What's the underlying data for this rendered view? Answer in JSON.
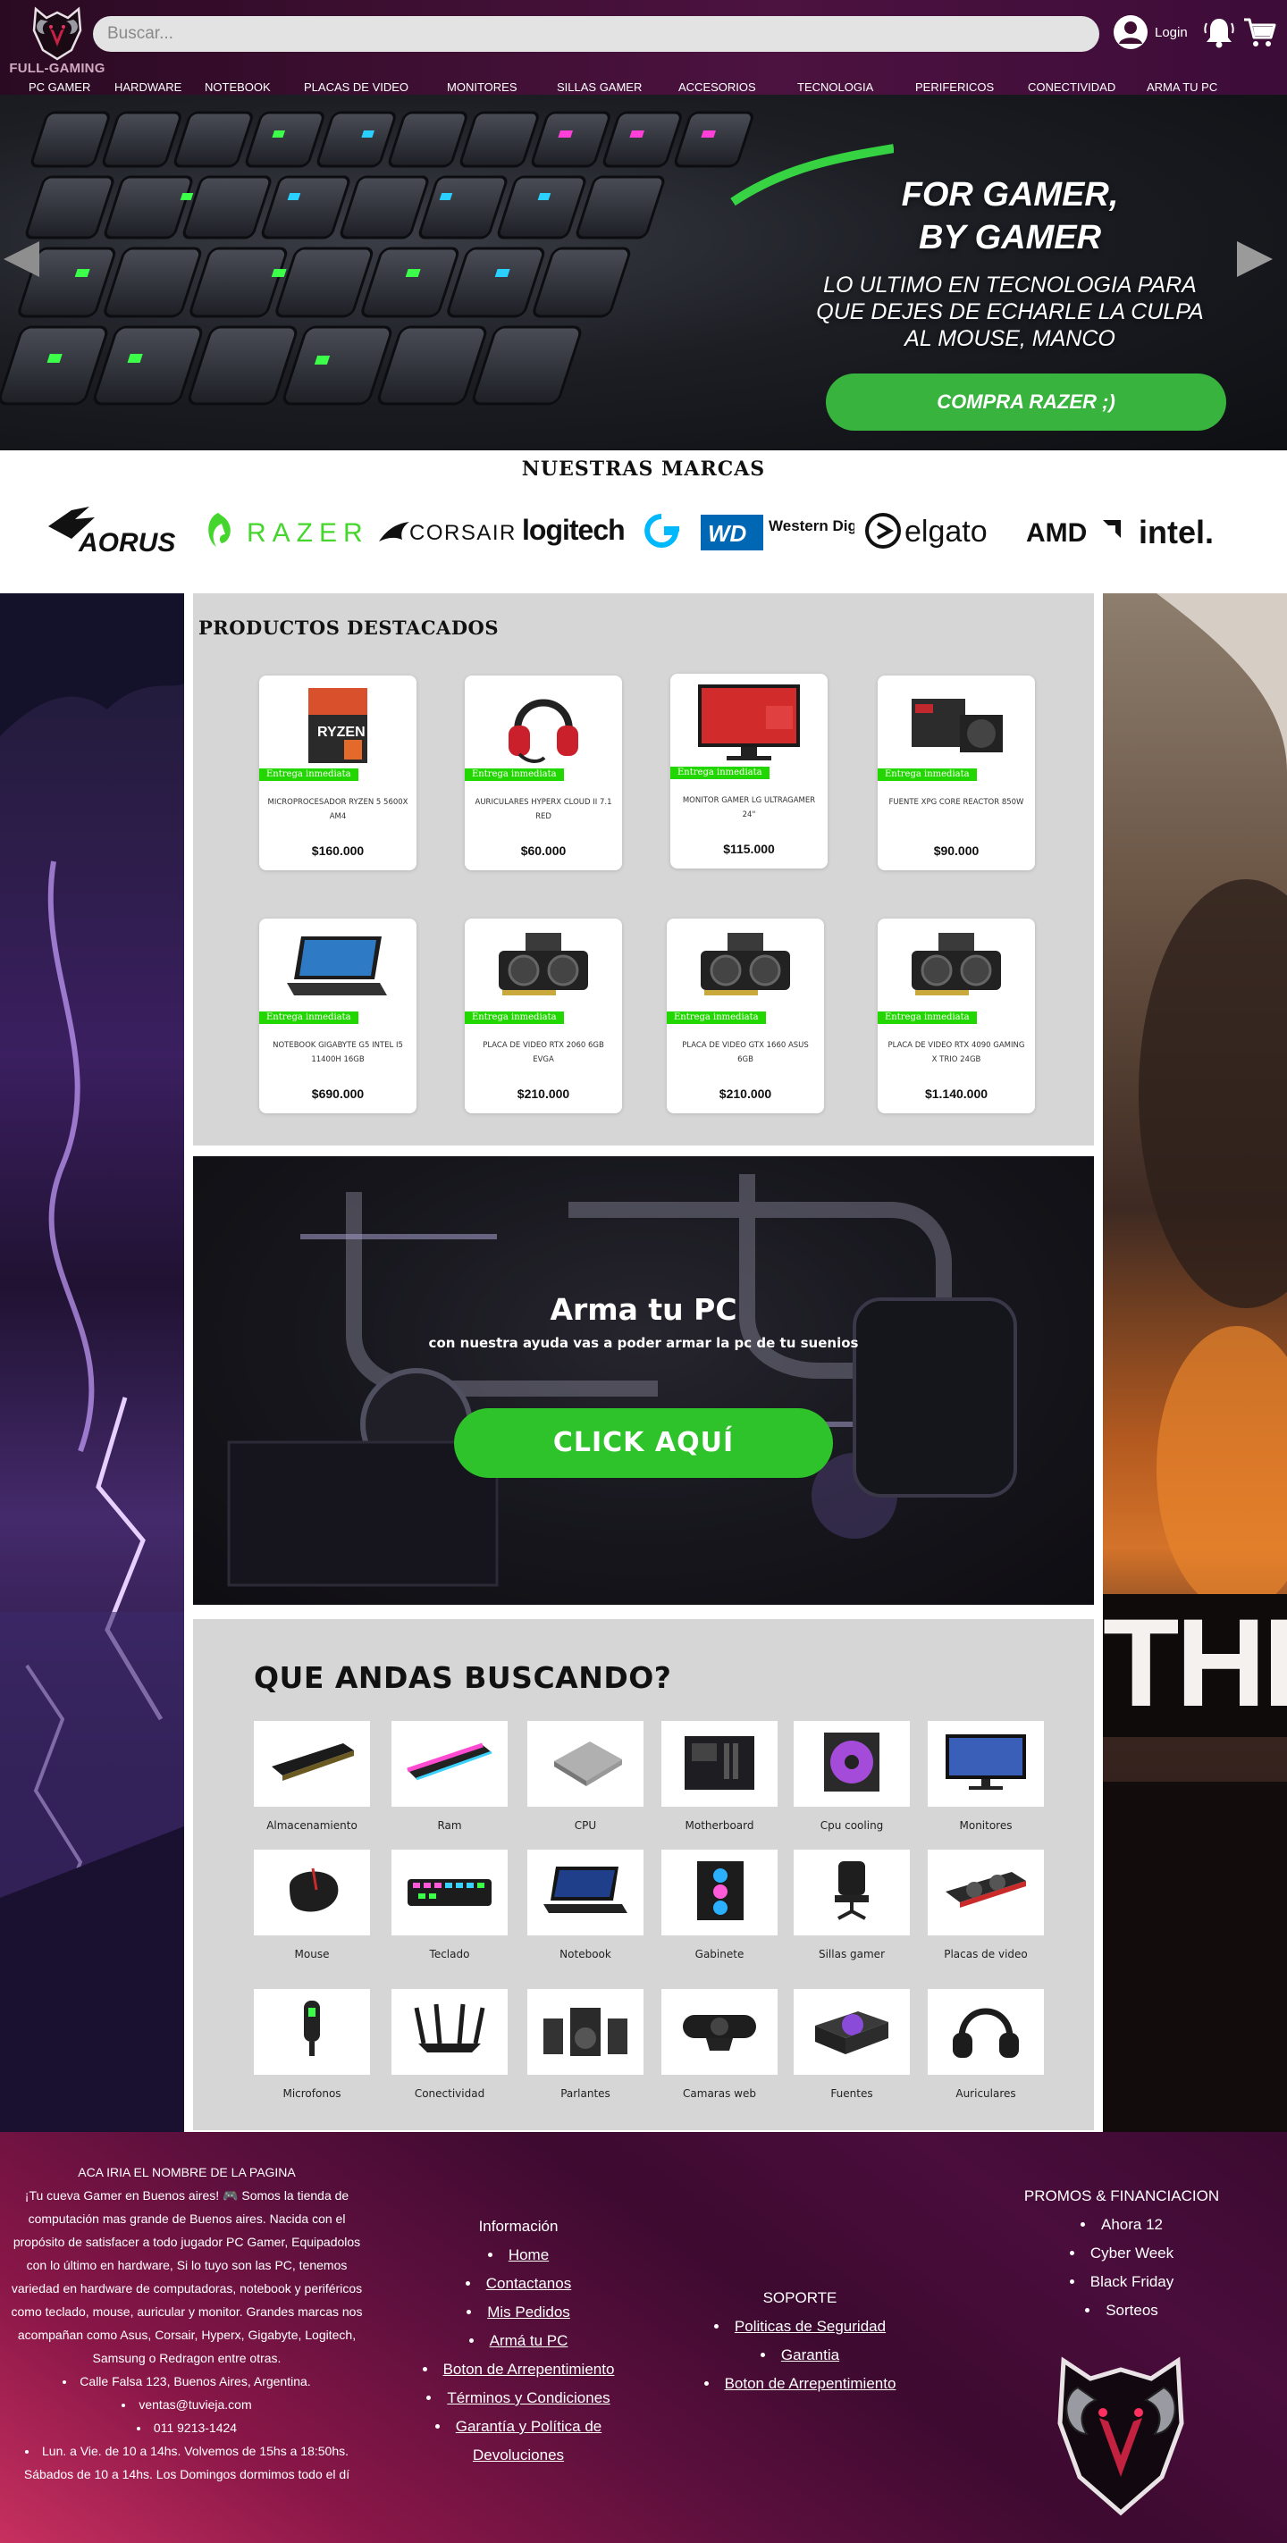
{
  "header": {
    "logo_text": "FULL-GAMING",
    "search_placeholder": "Buscar...",
    "login_label": "Login",
    "nav": [
      "PC GAMER",
      "HARDWARE",
      "NOTEBOOK",
      "PLACAS DE VIDEO",
      "MONITORES",
      "SILLAS GAMER",
      "ACCESORIOS",
      "TECNOLOGIA",
      "PERIFERICOS",
      "CONECTIVIDAD",
      "ARMA TU PC"
    ]
  },
  "hero": {
    "title_line1": "FOR GAMER,",
    "title_line2": "BY GAMER",
    "subtitle_line1": "LO ULTIMO EN TECNOLOGIA PARA",
    "subtitle_line2": "QUE DEJES DE ECHARLE LA CULPA",
    "subtitle_line3": "AL MOUSE, MANCO",
    "button": "COMPRA RAZER ;)"
  },
  "brands": {
    "title": "NUESTRAS MARCAS",
    "items": [
      "AORUS",
      "RAZER",
      "CORSAIR",
      "logitech",
      "Western Digital",
      "elgato",
      "AMD",
      "intel."
    ]
  },
  "products": {
    "title": "PRODUCTOS DESTACADOS",
    "badge": "Entrega inmediata",
    "items": [
      {
        "name": "MICROPROCESADOR RYZEN 5 5600X AM4",
        "price": "$160.000",
        "icon": "cpu-box-icon"
      },
      {
        "name": "AURICULARES HYPERX CLOUD II 7.1 RED",
        "price": "$60.000",
        "icon": "headset-icon"
      },
      {
        "name": "MONITOR GAMER LG ULTRAGAMER 24\"",
        "price": "$115.000",
        "icon": "monitor-icon"
      },
      {
        "name": "FUENTE XPG CORE REACTOR 850W",
        "price": "$90.000",
        "icon": "psu-icon"
      },
      {
        "name": "NOTEBOOK GIGABYTE G5 INTEL I5 11400H 16GB",
        "price": "$690.000",
        "icon": "notebook-icon"
      },
      {
        "name": "PLACA DE VIDEO RTX 2060 6GB EVGA",
        "price": "$210.000",
        "icon": "gpu-icon"
      },
      {
        "name": "PLACA DE VIDEO GTX 1660 ASUS 6GB",
        "price": "$210.000",
        "icon": "gpu-icon"
      },
      {
        "name": "PLACA DE VIDEO RTX 4090 GAMING X TRIO 24GB",
        "price": "$1.140.000",
        "icon": "gpu-icon"
      }
    ]
  },
  "arma": {
    "title": "Arma tu PC",
    "subtitle": "con nuestra ayuda vas a poder armar la pc de tu suenios",
    "button": "CLICK AQUÍ"
  },
  "categories": {
    "title": "QUE ANDAS BUSCANDO?",
    "items": [
      "Almacenamiento",
      "Ram",
      "CPU",
      "Motherboard",
      "Cpu cooling",
      "Monitores",
      "Mouse",
      "Teclado",
      "Notebook",
      "Gabinete",
      "Sillas gamer",
      "Placas de video",
      "Microfonos",
      "Conectividad",
      "Parlantes",
      "Camaras web",
      "Fuentes",
      "Auriculares"
    ]
  },
  "footer": {
    "about_title": "ACA IRIA EL NOMBRE DE LA PAGINA",
    "about_text": "¡Tu cueva Gamer en Buenos aires! 🎮 Somos la tienda de computación mas grande de Buenos aires. Nacida con el propósito de satisfacer a todo jugador PC Gamer, Equipadolos con lo último en hardware, Si lo tuyo son las PC, tenemos variedad en hardware de computadoras, notebook y periféricos como teclado, mouse, auricular y monitor. Grandes marcas nos acompañan como Asus, Corsair, Hyperx, Gigabyte, Logitech, Samsung o Redragon entre otras.",
    "address": "Calle Falsa 123, Buenos Aires, Argentina.",
    "email": "ventas@tuvieja.com",
    "phone": "011 9213-1424",
    "hours": "Lun. a Vie. de 10 a 14hs. Volvemos de 15hs a 18:50hs. Sábados de 10 a 14hs. Los Domingos dormimos todo el dí",
    "info_title": "Información",
    "info_links": [
      "Home",
      "Contactanos",
      "Mis Pedidos",
      "Armá tu PC",
      "Boton de Arrepentimiento",
      "Términos y Condiciones",
      "Garantía y Política de Devoluciones"
    ],
    "support_title": "SOPORTE",
    "support_links": [
      "Politicas de Seguridad",
      "Garantia",
      "Boton de Arrepentimiento"
    ],
    "promos_title": "PROMOS & FINANCIACION",
    "promos": [
      "Ahora 12",
      "Cyber Week",
      "Black Friday",
      "Sorteos"
    ]
  },
  "colors": {
    "header_bg": "#3f0f33",
    "accent_green": "#37b33e",
    "badge_green": "#22d600",
    "panel_gray": "#d6d6d6"
  }
}
